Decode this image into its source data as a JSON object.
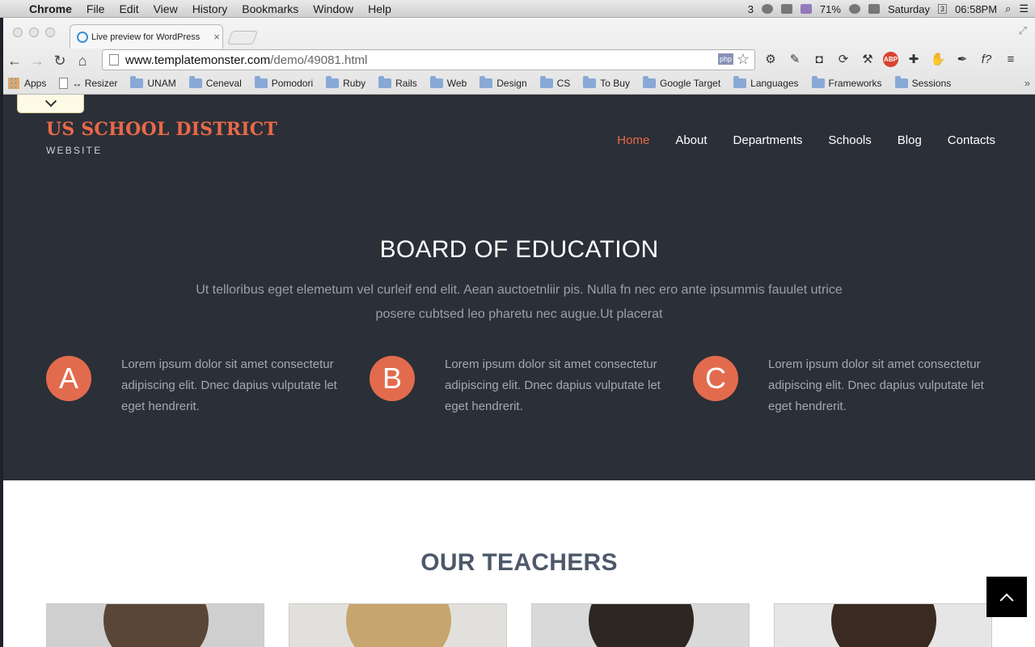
{
  "menubar": {
    "app": "Chrome",
    "items": [
      "File",
      "Edit",
      "View",
      "History",
      "Bookmarks",
      "Window",
      "Help"
    ],
    "notif_count": "3",
    "battery": "71%",
    "day": "Saturday",
    "day_badge": "3",
    "time": "06:58PM"
  },
  "browser": {
    "tab_title": "Live preview for WordPress",
    "url_host": "www.templatemonster.com",
    "url_path": "/demo/49081.html",
    "php_badge": "php",
    "abp_label": "ABP",
    "bookmarks": [
      {
        "label": "Apps",
        "kind": "apps"
      },
      {
        "label": "↔ Resizer",
        "kind": "page"
      },
      {
        "label": "UNAM",
        "kind": "folder"
      },
      {
        "label": "Ceneval",
        "kind": "folder"
      },
      {
        "label": "Pomodori",
        "kind": "folder"
      },
      {
        "label": "Ruby",
        "kind": "folder"
      },
      {
        "label": "Rails",
        "kind": "folder"
      },
      {
        "label": "Web",
        "kind": "folder"
      },
      {
        "label": "Design",
        "kind": "folder"
      },
      {
        "label": "CS",
        "kind": "folder"
      },
      {
        "label": "To Buy",
        "kind": "folder"
      },
      {
        "label": "Google Target",
        "kind": "folder"
      },
      {
        "label": "Languages",
        "kind": "folder"
      },
      {
        "label": "Frameworks",
        "kind": "folder"
      },
      {
        "label": "Sessions",
        "kind": "folder"
      }
    ],
    "more": "»"
  },
  "site": {
    "logo_title": "US SCHOOL DISTRICT",
    "logo_subtitle": "WEBSITE",
    "nav": [
      {
        "label": "Home",
        "active": true
      },
      {
        "label": "About",
        "active": false
      },
      {
        "label": "Departments",
        "active": false
      },
      {
        "label": "Schools",
        "active": false
      },
      {
        "label": "Blog",
        "active": false
      },
      {
        "label": "Contacts",
        "active": false
      }
    ],
    "hero_title": "BOARD OF EDUCATION",
    "hero_lead": "Ut telloribus eget elemetum vel curleif end elit. Aean auctoetnliir pis. Nulla fn nec ero ante ipsummis fauulet utrice posere cubtsed leo pharetu nec augue.Ut placerat",
    "features": [
      {
        "letter": "A",
        "text": "Lorem ipsum dolor sit amet consectetur adipiscing elit. Dnec dapius vulputate let eget hendrerit."
      },
      {
        "letter": "B",
        "text": "Lorem ipsum dolor sit amet consectetur adipiscing elit. Dnec dapius vulputate let eget hendrerit."
      },
      {
        "letter": "C",
        "text": "Lorem ipsum dolor sit amet consectetur adipiscing elit. Dnec dapius vulputate let eget hendrerit."
      }
    ],
    "teachers_title": "OUR TEACHERS",
    "colors": {
      "accent": "#e8694a",
      "hero_bg": "#2b2f37",
      "badge": "#e36b4d",
      "teachers_title": "#4d596a"
    }
  }
}
